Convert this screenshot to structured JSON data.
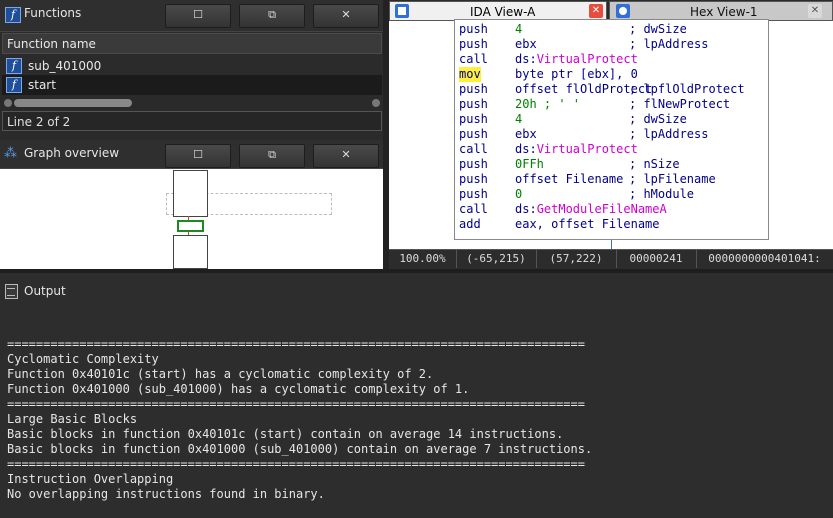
{
  "functions_pane": {
    "title": "Functions",
    "btn_restore": "☐",
    "btn_float": "⧉",
    "btn_close": "✕",
    "column_header": "Function name",
    "rows": [
      {
        "name": "sub_401000"
      },
      {
        "name": "start"
      }
    ],
    "status": "Line 2 of 2"
  },
  "graph_overview": {
    "title": "Graph overview",
    "btn_restore": "☐",
    "btn_float": "⧉",
    "btn_close": "✕"
  },
  "tabs": {
    "ida_view": "IDA View-A",
    "hex_view": "Hex View-1",
    "close": "✕"
  },
  "disasm": {
    "lines": [
      {
        "mnemonic": "push",
        "operand": "4",
        "comment": "; dwSize"
      },
      {
        "mnemonic": "push",
        "operand": "ebx",
        "comment": "; lpAddress"
      },
      {
        "mnemonic": "call",
        "operand_prefix": "ds:",
        "operand_import": "VirtualProtect",
        "comment": ""
      },
      {
        "mnemonic": "mov",
        "operand": "byte ptr [ebx], 0",
        "comment": "",
        "highlight": true
      },
      {
        "mnemonic": "push",
        "operand": "offset flOldProtect",
        "comment": "; lpflOldProtect"
      },
      {
        "mnemonic": "push",
        "operand": "20h ; ' '",
        "comment": "; flNewProtect"
      },
      {
        "mnemonic": "push",
        "operand": "4",
        "comment": "; dwSize"
      },
      {
        "mnemonic": "push",
        "operand": "ebx",
        "comment": "; lpAddress"
      },
      {
        "mnemonic": "call",
        "operand_prefix": "ds:",
        "operand_import": "VirtualProtect",
        "comment": ""
      },
      {
        "mnemonic": "push",
        "operand": "0FFh",
        "comment": "; nSize"
      },
      {
        "mnemonic": "push",
        "operand": "offset Filename",
        "comment": "; lpFilename"
      },
      {
        "mnemonic": "push",
        "operand": "0",
        "comment": "; hModule"
      },
      {
        "mnemonic": "call",
        "operand_prefix": "ds:",
        "operand_import": "GetModuleFileNameA",
        "comment": ""
      },
      {
        "mnemonic": "add",
        "operand": "eax, offset Filename",
        "comment": ""
      }
    ]
  },
  "statusbar": {
    "zoom": "100.00%",
    "coord1": "(-65,215)",
    "coord2": "(57,222)",
    "offset": "00000241",
    "address": "0000000000401041:"
  },
  "output_pane": {
    "title": "Output",
    "lines": [
      "================================================================================",
      "Cyclomatic Complexity",
      "Function 0x40101c (start) has a cyclomatic complexity of 2.",
      "Function 0x401000 (sub_401000) has a cyclomatic complexity of 1.",
      "================================================================================",
      "Large Basic Blocks",
      "Basic blocks in function 0x40101c (start) contain on average 14 instructions.",
      "Basic blocks in function 0x401000 (sub_401000) contain on average 7 instructions.",
      "================================================================================",
      "Instruction Overlapping",
      "No overlapping instructions found in binary."
    ]
  },
  "colors": {
    "accent": "#2f6fd6",
    "highlight": "#ffef3a",
    "import": "#d000d0"
  }
}
